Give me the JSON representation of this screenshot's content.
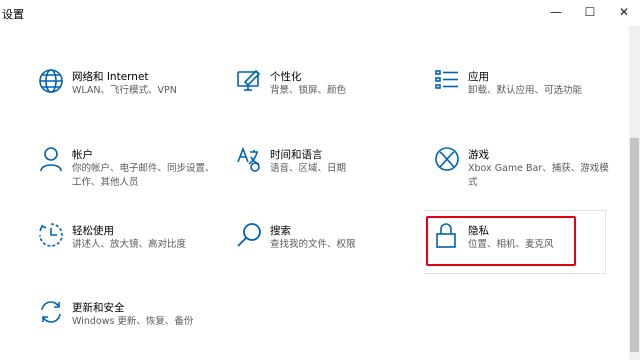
{
  "window": {
    "title": "设置",
    "minimize_label": "—",
    "maximize_label": "☐",
    "close_label": "✕"
  },
  "tiles": [
    {
      "title": "网络和 Internet",
      "desc": "WLAN、飞行模式、VPN",
      "icon": "globe-icon"
    },
    {
      "title": "个性化",
      "desc": "背景、锁屏、颜色",
      "icon": "personalization-icon"
    },
    {
      "title": "应用",
      "desc": "卸载、默认应用、可选功能",
      "icon": "apps-icon"
    },
    {
      "title": "帐户",
      "desc": "你的帐户、电子邮件、同步设置、工作、其他人员",
      "icon": "person-icon"
    },
    {
      "title": "时间和语言",
      "desc": "语音、区域、日期",
      "icon": "time-language-icon"
    },
    {
      "title": "游戏",
      "desc": "Xbox Game Bar、捕获、游戏模式",
      "icon": "xbox-icon"
    },
    {
      "title": "轻松使用",
      "desc": "讲述人、放大镜、高对比度",
      "icon": "ease-of-access-icon"
    },
    {
      "title": "搜索",
      "desc": "查找我的文件、权限",
      "icon": "search-icon"
    },
    {
      "title": "隐私",
      "desc": "位置、相机、麦克风",
      "icon": "lock-icon"
    },
    {
      "title": "更新和安全",
      "desc": "Windows 更新、恢复、备份",
      "icon": "update-icon"
    }
  ],
  "colors": {
    "accent": "#0063b1",
    "highlight": "#e60012"
  }
}
